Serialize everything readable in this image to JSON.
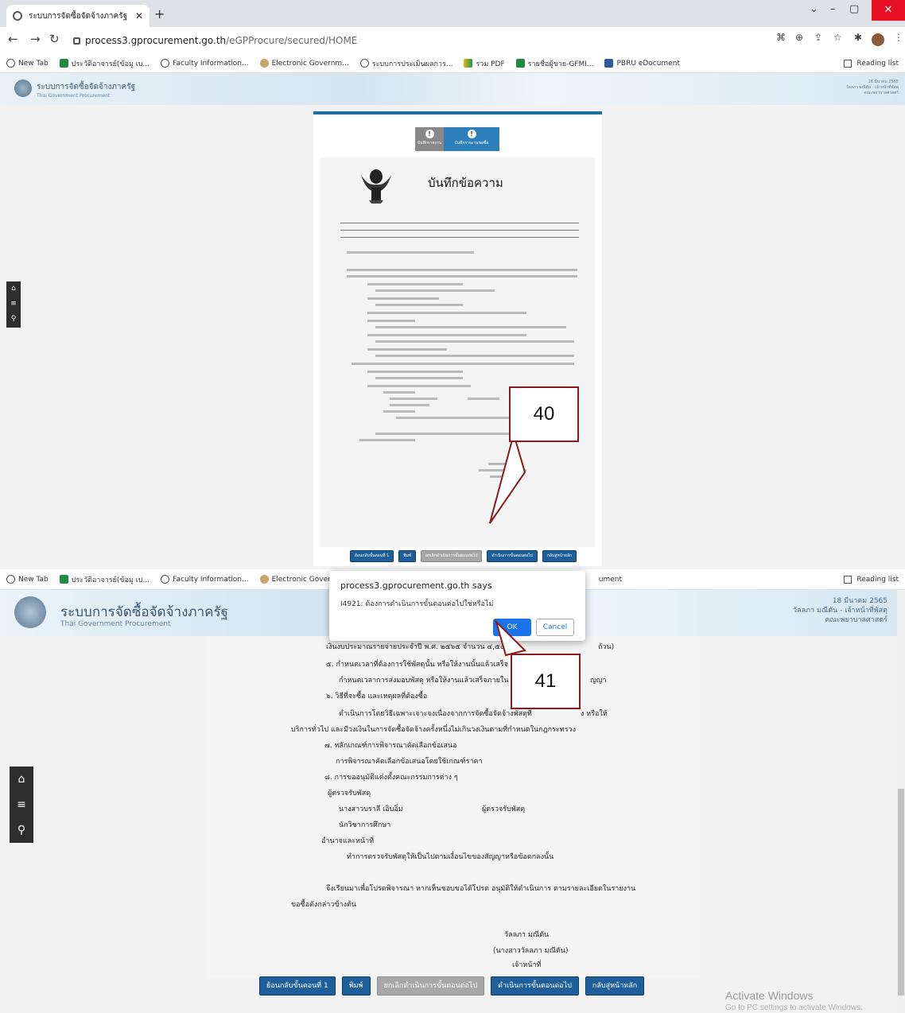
{
  "browser": {
    "tab_title": "ระบบการจัดซื้อจัดจ้างภาครัฐ",
    "url_host": "process3.gprocurement.go.th",
    "url_path": "/eGPProcure/secured/HOME",
    "bookmarks": [
      "New Tab",
      "ประวัติอาจารย์(ข้อมู เบ...",
      "Faculty Information...",
      "Electronic Governm...",
      "ระบบการประเมินผลการ...",
      "รวม PDF",
      "รายชื่อผู้ขาย-GFMI...",
      "PBRU eDocument"
    ],
    "bookmarks2": [
      "New Tab",
      "ประวัติอาจารย์(ข้อมู เบ...",
      "Faculty Information...",
      "Electronic Governm...",
      "ument"
    ],
    "reading_list": "Reading list"
  },
  "site": {
    "title": "ระบบการจัดซื้อจัดจ้างภาครัฐ",
    "subtitle": "Thai Government Procurement",
    "date": "18 มีนาคม 2565",
    "user": "วัลลภา มณีตัน - เจ้าหน้าที่พัสดุ",
    "dept": "คณะพยาบาลศาสตร์"
  },
  "memo": {
    "title": "บันทึกข้อความ",
    "lines": [
      "เงินงบประมาณรายจ่ายประจำปี พ.ศ. ๒๕๖๕ จำนวน ๔,๕๐๐.๐๐",
      "ถ้วน)",
      "๕. กำหนดเวลาที่ต้องการใช้พัสดุนั้น หรือให้งานนั้นแล้วเสร็จ",
      "กำหนดเวลาการส่งมอบพัสดุ หรือให้งานแล้วเสร็จภายใน ๓๐ วัน",
      "ญญา",
      "๖. วิธีที่จะซื้อ และเหตุผลที่ต้องซื้อ",
      "ดำเนินการโดยวิธีเฉพาะเจาะจงเนื่องจากการจัดซื้อจัดจ้างพัสดุที่",
      "ง หรือให้",
      "บริการทั่วไป และมีวงเงินในการจัดซื้อจัดจ้างครั้งหนึ่งไม่เกินวงเงินตามที่กำหนดในกฎกระทรวง",
      "๗. หลักเกณฑ์การพิจารณาคัดเลือกข้อเสนอ",
      "การพิจารณาคัดเลือกข้อเสนอโดยใช้เกณฑ์ราคา",
      "๘. การขออนุมัติแต่งตั้งคณะกรรมการต่าง ๆ",
      "ผู้ตรวจรับพัสดุ",
      "นางสาวบราลี เอิบอิ่ม",
      "ผู้ตรวจรับพัสดุ",
      "นักวิชาการศึกษา",
      "อำนาจและหน้าที่",
      "ทำการตรวจรับพัสดุให้เป็นไปตามเงื่อนไขของสัญญาหรือข้อตกลงนั้น",
      "จึงเรียนมาเพื่อโปรดพิจารณา หากเห็นชอบขอได้โปรด อนุมัติให้ดำเนินการ ตามรายละเอียดในรายงาน",
      "ขอซื้อดังกล่าวข้างต้น",
      "วัลลภา มณีตัน",
      "(นางสาววัลลภา มณีตัน)",
      "เจ้าหน้าที่"
    ]
  },
  "buttons": {
    "back": "ย้อนกลับขั้นตอนที่ 1",
    "print": "พิมพ์",
    "cancel_step": "ยกเลิกดำเนินการขั้นตอนต่อไป",
    "next": "ดำเนินการขั้นตอนต่อไป",
    "home": "กลับสู่หน้าหลัก"
  },
  "steps": [
    "บันทึกรายงาน",
    "บันทึกรายงานขอซื้อ"
  ],
  "dialog": {
    "host": "process3.gprocurement.go.th says",
    "message": "I4921: ต้องการดำเนินการขั้นตอนต่อไปใช่หรือไม่",
    "ok": "OK",
    "cancel": "Cancel"
  },
  "callouts": [
    "40",
    "41"
  ],
  "activate": {
    "title": "Activate Windows",
    "sub": "Go to PC settings to activate Windows."
  },
  "icons": [
    "home-icon",
    "menu-icon",
    "search-icon",
    "garuda-emblem"
  ]
}
